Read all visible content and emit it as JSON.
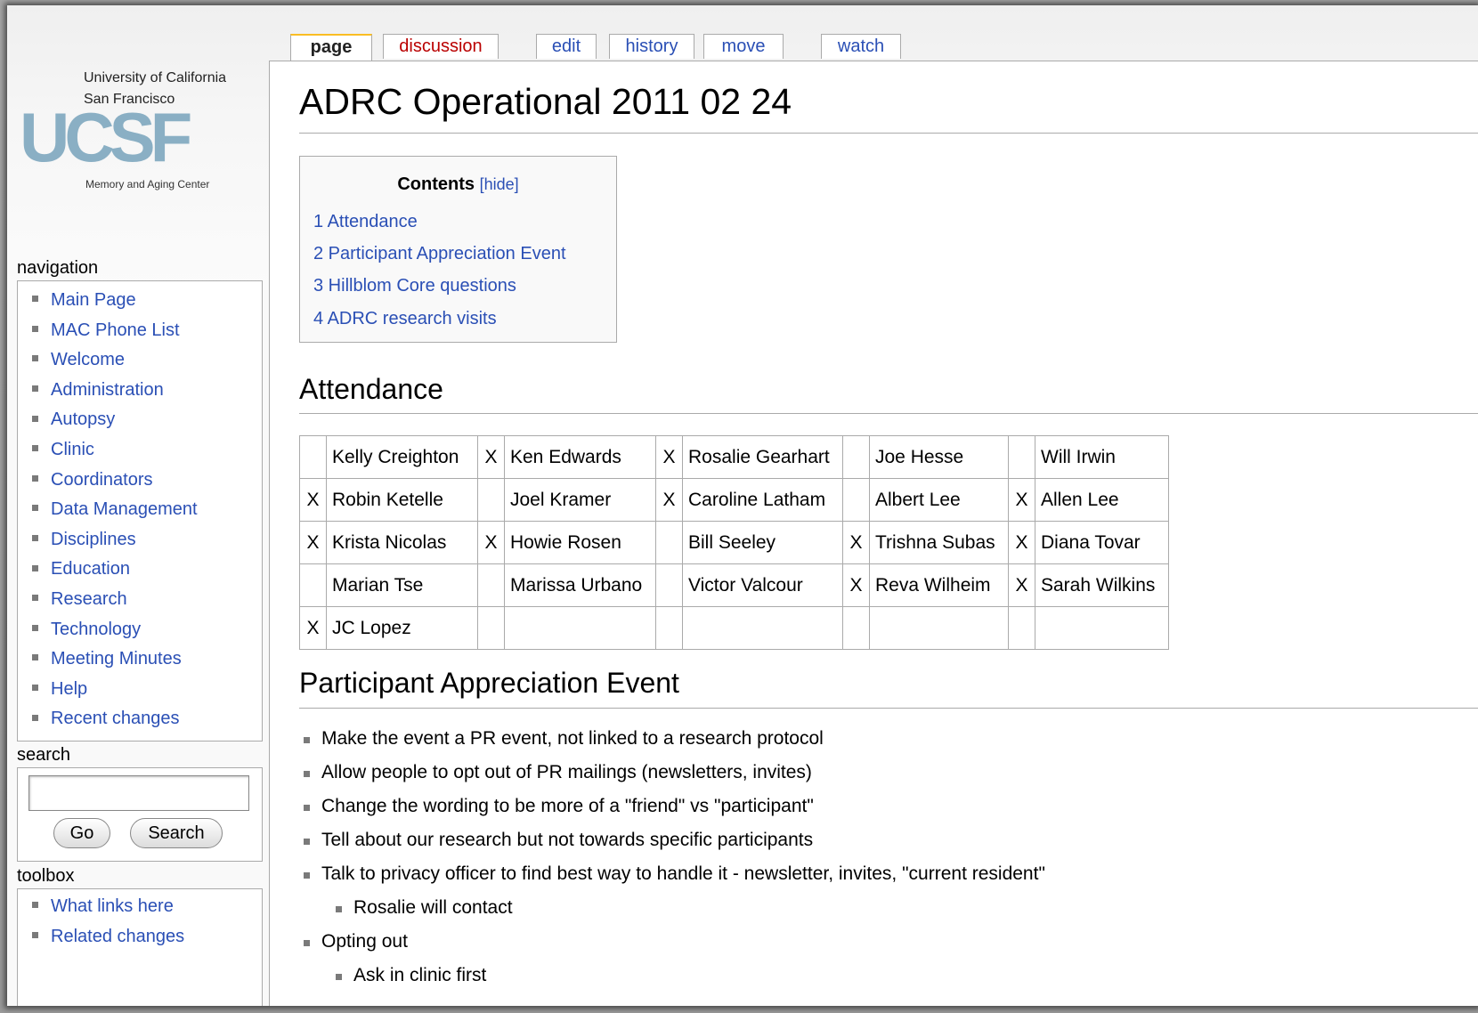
{
  "logo": {
    "line1": "University of California",
    "line2": "San Francisco",
    "mark": "UCSF",
    "subtitle": "Memory and Aging Center"
  },
  "tabs": [
    {
      "label": "page",
      "selected": true
    },
    {
      "label": "discussion",
      "new": true
    },
    {
      "label": "edit"
    },
    {
      "label": "history"
    },
    {
      "label": "move"
    },
    {
      "label": "watch"
    }
  ],
  "page": {
    "title": "ADRC Operational 2011 02 24"
  },
  "toc": {
    "title": "Contents",
    "hide_label": "[hide]",
    "items": [
      "1 Attendance",
      "2 Participant Appreciation Event",
      "3 Hillblom Core questions",
      "4 ADRC research visits"
    ]
  },
  "attendance": {
    "heading": "Attendance",
    "rows": [
      [
        [
          "",
          "Kelly Creighton"
        ],
        [
          "X",
          "Ken Edwards"
        ],
        [
          "X",
          "Rosalie Gearhart"
        ],
        [
          "",
          "Joe Hesse"
        ],
        [
          "",
          "Will Irwin"
        ]
      ],
      [
        [
          "X",
          "Robin Ketelle"
        ],
        [
          "",
          "Joel Kramer"
        ],
        [
          "X",
          "Caroline Latham"
        ],
        [
          "",
          "Albert Lee"
        ],
        [
          "X",
          "Allen Lee"
        ]
      ],
      [
        [
          "X",
          "Krista Nicolas"
        ],
        [
          "X",
          "Howie Rosen"
        ],
        [
          "",
          "Bill Seeley"
        ],
        [
          "X",
          "Trishna Subas"
        ],
        [
          "X",
          "Diana Tovar"
        ]
      ],
      [
        [
          "",
          "Marian Tse"
        ],
        [
          "",
          "Marissa Urbano"
        ],
        [
          "",
          "Victor Valcour"
        ],
        [
          "X",
          "Reva Wilheim"
        ],
        [
          "X",
          "Sarah Wilkins"
        ]
      ],
      [
        [
          "X",
          "JC Lopez"
        ],
        [
          "",
          ""
        ],
        [
          "",
          ""
        ],
        [
          "",
          ""
        ],
        [
          "",
          ""
        ]
      ]
    ]
  },
  "event": {
    "heading": "Participant Appreciation Event",
    "bullets": [
      {
        "text": "Make the event a PR event, not linked to a research protocol",
        "level": 1
      },
      {
        "text": "Allow people to opt out of PR mailings (newsletters, invites)",
        "level": 1
      },
      {
        "text": "Change the wording to be more of a \"friend\" vs \"participant\"",
        "level": 1
      },
      {
        "text": "Tell about our research but not towards specific participants",
        "level": 1
      },
      {
        "text": "Talk to privacy officer to find best way to handle it - newsletter, invites, \"current resident\"",
        "level": 1
      },
      {
        "text": "Rosalie will contact",
        "level": 2
      },
      {
        "text": "Opting out",
        "level": 1
      },
      {
        "text": "Ask in clinic first",
        "level": 2
      }
    ]
  },
  "sidebar": {
    "navigation": {
      "heading": "navigation",
      "items": [
        "Main Page",
        "MAC Phone List",
        "Welcome",
        "Administration",
        "Autopsy",
        "Clinic",
        "Coordinators",
        "Data Management",
        "Disciplines",
        "Education",
        "Research",
        "Technology",
        "Meeting Minutes",
        "Help",
        "Recent changes"
      ]
    },
    "search": {
      "heading": "search",
      "value": "",
      "go_label": "Go",
      "search_label": "Search"
    },
    "toolbox": {
      "heading": "toolbox",
      "items": [
        "What links here",
        "Related changes"
      ]
    }
  },
  "colors": {
    "link": "#2a4fb5",
    "new_link": "#ba0000",
    "selected_tab_accent": "#fabd23",
    "border": "#aaaaaa"
  }
}
